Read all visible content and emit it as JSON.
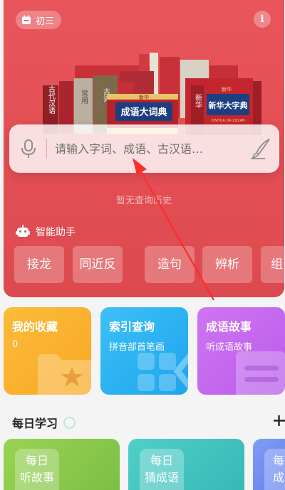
{
  "header": {
    "grade": "初三",
    "info_label": "i"
  },
  "books": {
    "left_spine_1": "古代汉语",
    "left_spine_2": "常用",
    "left_spine_3": "古诗",
    "center_title": "成语大词典",
    "center_publisher": "新华",
    "right_title": "新华大字典",
    "right_publisher": "新华",
    "right_pinyin": "XINHUA DA ZIDIAN",
    "right_spine": "新华"
  },
  "search": {
    "placeholder": "请输入字词、成语、古汉语…"
  },
  "history_empty": "暂无查询历史",
  "assistant": {
    "label": "智能助手",
    "chips": [
      "接龙",
      "同近反",
      "造句",
      "辨析",
      "组"
    ]
  },
  "cards": [
    {
      "title": "我的收藏",
      "subtitle": "0",
      "color": "#fbb131"
    },
    {
      "title": "索引查询",
      "subtitle": "拼音部首笔画",
      "color": "#2fb4f2"
    },
    {
      "title": "成语故事",
      "subtitle": "听成语故事",
      "color": "#c768f0"
    }
  ],
  "daily": {
    "title": "每日学习",
    "cards": [
      {
        "line1": "每日",
        "line2": "听故事",
        "color": "#89c94b"
      },
      {
        "line1": "每日",
        "line2": "猜成语",
        "color": "#45c3c0"
      },
      {
        "line1": "每",
        "line2": "成",
        "color": "#6e8ef2"
      }
    ]
  },
  "icons": {
    "calendar": "calendar-icon",
    "info": "info-icon",
    "microphone": "microphone-icon",
    "handwriting": "brush-icon",
    "assistant": "robot-icon",
    "plus": "plus-icon"
  }
}
